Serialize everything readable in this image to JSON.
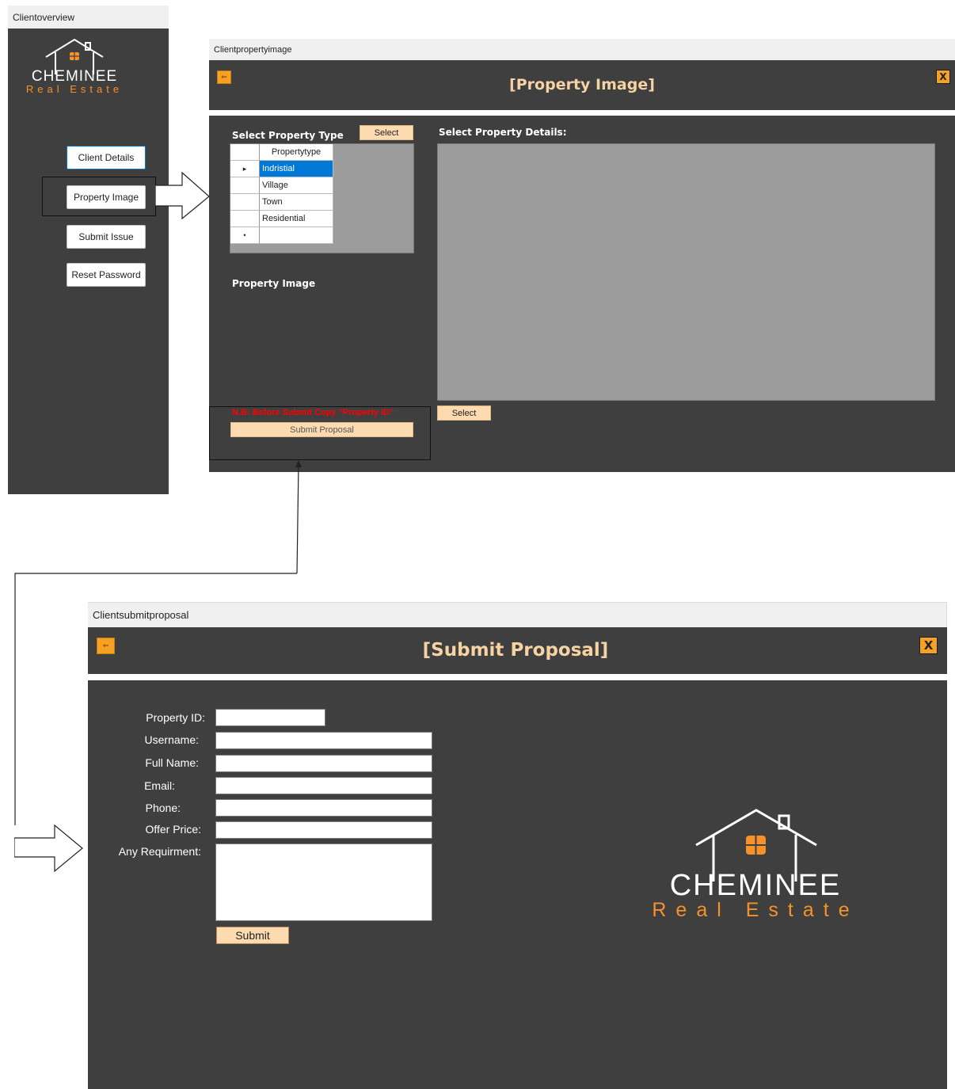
{
  "overview": {
    "window_title": "Clientoverview",
    "logo": {
      "word": "CHEMINEE",
      "sub": "Real Estate"
    },
    "buttons": [
      "Client Details",
      "Property Image",
      "Submit Issue",
      "Reset Password"
    ]
  },
  "property_image": {
    "window_title": "Clientpropertyimage",
    "back_label": "⇐",
    "title": "[Property Image]",
    "close_label": "X",
    "select_type_label": "Select Property Type",
    "select_type_button": "Select",
    "grid": {
      "header": "Propertytype",
      "rows": [
        "Indristial",
        "Village",
        "Town",
        "Residential",
        ""
      ],
      "row_markers": [
        "▸",
        "",
        "",
        "",
        "•"
      ]
    },
    "details_label": "Select Property Details:",
    "details_select_button": "Select",
    "image_label": "Property Image",
    "note": "N.B: Before Submit Copy \"Property ID\"",
    "submit_button": "Submit Proposal"
  },
  "submit_proposal": {
    "window_title": "Clientsubmitproposal",
    "back_label": "⇐",
    "title": "[Submit Proposal]",
    "close_label": "X",
    "fields": {
      "property_id": {
        "label": "Property ID:",
        "value": ""
      },
      "username": {
        "label": "Username:",
        "value": ""
      },
      "full_name": {
        "label": "Full Name:",
        "value": ""
      },
      "email": {
        "label": "Email:",
        "value": ""
      },
      "phone": {
        "label": "Phone:",
        "value": ""
      },
      "offer_price": {
        "label": "Offer Price:",
        "value": ""
      },
      "requirement": {
        "label": "Any Requirment:",
        "value": ""
      }
    },
    "submit_button": "Submit",
    "logo": {
      "word": "CHEMINEE",
      "sub": "Real Estate"
    }
  },
  "colors": {
    "panel_dark": "#3f3f3f",
    "accent_orange": "#f4a124",
    "title_peach": "#f6d3a2",
    "note_red": "#ff0000",
    "selection_blue": "#0078d7"
  }
}
